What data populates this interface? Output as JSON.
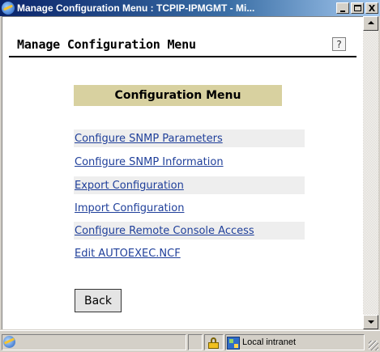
{
  "window": {
    "title": "Manage Configuration Menu : TCPIP-IPMGMT - Mi...",
    "minimize_glyph": "",
    "maximize_glyph": "",
    "close_glyph": "X"
  },
  "header": {
    "title": "Manage Configuration Menu",
    "help_glyph": "?"
  },
  "menu": {
    "heading": "Configuration Menu",
    "items": [
      {
        "label": "Configure SNMP Parameters"
      },
      {
        "label": "Configure SNMP Information"
      },
      {
        "label": "Export Configuration"
      },
      {
        "label": "Import Configuration"
      },
      {
        "label": "Configure Remote Console Access "
      },
      {
        "label": "Edit AUTOEXEC.NCF"
      }
    ]
  },
  "actions": {
    "back_label": "Back"
  },
  "statusbar": {
    "zone": "Local intranet"
  },
  "icons": {
    "window": "ie-icon",
    "help": "help-icon",
    "page": "ie-page-icon",
    "secure": "lock-icon",
    "zone": "local-intranet-icon"
  },
  "colors": {
    "link": "#1f3f9a",
    "heading_bg": "#d8d1a0",
    "shaded_row": "#eeeeee",
    "titlebar": "#0a246a"
  }
}
